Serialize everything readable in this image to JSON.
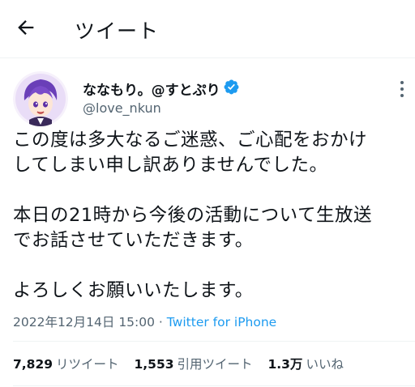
{
  "header": {
    "title": "ツイート",
    "back_icon": "arrow-left-icon"
  },
  "author": {
    "display_name": "ななもり。@すとぷり",
    "handle": "@love_nkun",
    "verified": true,
    "verified_color": "#1d9bf0",
    "avatar_icon": "avatar-anime-purple-hair"
  },
  "tweet": {
    "lines": [
      "この度は多大なるご迷惑、ご心配をおかけ",
      "してしまい申し訳ありませんでした。",
      "",
      "本日の21時から今後の活動について生放送",
      "でお話させていただきます。",
      "",
      "よろしくお願いいたします。"
    ],
    "datetime": "2022年12月14日 15:00",
    "separator": " · ",
    "source": "Twitter for iPhone"
  },
  "stats": {
    "retweets": {
      "count": "7,829",
      "label": "リツイート"
    },
    "quotes": {
      "count": "1,553",
      "label": "引用ツイート"
    },
    "likes": {
      "count": "1.3万",
      "label": "いいね"
    }
  },
  "colors": {
    "text": "#0f1419",
    "muted": "#536471",
    "link": "#1d9bf0",
    "divider": "#eff3f4"
  }
}
